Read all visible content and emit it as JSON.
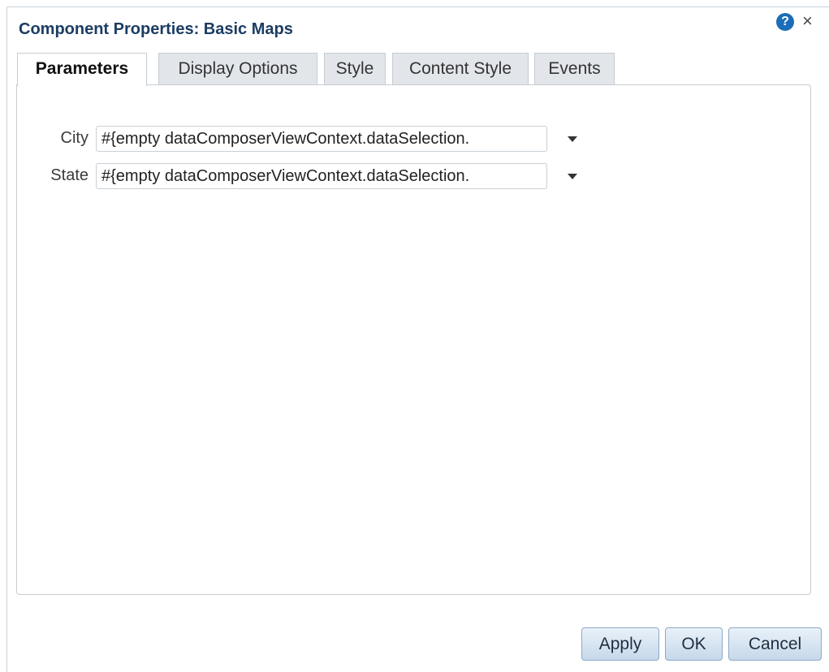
{
  "dialog": {
    "title": "Component Properties: Basic Maps",
    "help_icon": "?",
    "close_icon": "×"
  },
  "tabs": [
    {
      "label": "Parameters",
      "active": true
    },
    {
      "label": "Display Options",
      "active": false
    },
    {
      "label": "Style",
      "active": false
    },
    {
      "label": "Content Style",
      "active": false
    },
    {
      "label": "Events",
      "active": false
    }
  ],
  "parameters": [
    {
      "label": "City",
      "value": "#{empty dataComposerViewContext.dataSelection."
    },
    {
      "label": "State",
      "value": "#{empty dataComposerViewContext.dataSelection."
    }
  ],
  "buttons": {
    "apply": "Apply",
    "ok": "OK",
    "cancel": "Cancel"
  }
}
